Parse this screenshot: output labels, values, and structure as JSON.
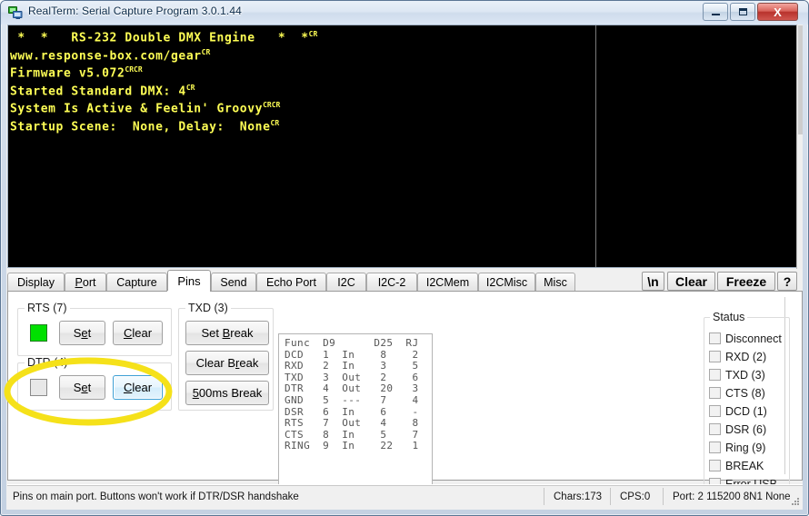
{
  "window": {
    "title": "RealTerm: Serial Capture Program 3.0.1.44",
    "icon": "monitor-icon",
    "minimize_label": "–",
    "maximize_label": "□",
    "close_label": "X"
  },
  "terminal": {
    "lines": [
      " *  *   RS-232 Double DMX Engine   *  *",
      "www.response-box.com/gear",
      "Firmware v5.072",
      "Started Standard DMX: 4",
      "System Is Active & Feelin' Groovy",
      "Startup Scene:  None, Delay:  None"
    ],
    "full_text": " *  *   RS-232 Double DMX Engine   *  *CR\nwww.response-box.com/gearCR\nFirmware v5.072CRCR\nStarted Standard DMX: 4CR\nSystem Is Active & Feelin' GroovyCRCR\nStartup Scene:  None, Delay:  NoneCR",
    "fg_color": "#ffff55",
    "bg_color": "#000000"
  },
  "tabs": [
    {
      "label": "Display",
      "active": false
    },
    {
      "label": "Port",
      "active": false
    },
    {
      "label": "Capture",
      "active": false
    },
    {
      "label": "Pins",
      "active": true
    },
    {
      "label": "Send",
      "active": false
    },
    {
      "label": "Echo Port",
      "active": false
    },
    {
      "label": "I2C",
      "active": false
    },
    {
      "label": "I2C-2",
      "active": false
    },
    {
      "label": "I2CMem",
      "active": false
    },
    {
      "label": "I2CMisc",
      "active": false
    },
    {
      "label": "Misc",
      "active": false
    }
  ],
  "toolbar": [
    {
      "label": "\\n",
      "name": "newline-button"
    },
    {
      "label": "Clear",
      "name": "clear-button"
    },
    {
      "label": "Freeze",
      "name": "freeze-button"
    },
    {
      "label": "?",
      "name": "help-button"
    }
  ],
  "rts_group": {
    "title": "RTS (7)",
    "led_state": "on",
    "led_color": "#00e000",
    "set_label": "Set",
    "clear_label": "Clear"
  },
  "dtr_group": {
    "title": "DTR (4)",
    "led_state": "off",
    "set_label": "Set",
    "clear_label": "Clear"
  },
  "txd_group": {
    "title": "TXD (3)",
    "set_break_label": "Set Break",
    "clear_break_label": "Clear Break",
    "ms_break_label": "500ms Break"
  },
  "pin_table": {
    "header": [
      "Func",
      "D9",
      "",
      "D25",
      "RJ"
    ],
    "rows": [
      [
        "DCD",
        "1",
        "In",
        "8",
        "2"
      ],
      [
        "RXD",
        "2",
        "In",
        "3",
        "5"
      ],
      [
        "TXD",
        "3",
        "Out",
        "2",
        "6"
      ],
      [
        "DTR",
        "4",
        "Out",
        "20",
        "3"
      ],
      [
        "GND",
        "5",
        "---",
        "7",
        "4"
      ],
      [
        "DSR",
        "6",
        "In",
        "6",
        "-"
      ],
      [
        "RTS",
        "7",
        "Out",
        "4",
        "8"
      ],
      [
        "CTS",
        "8",
        "In",
        "5",
        "7"
      ],
      [
        "RING",
        "9",
        "In",
        "22",
        "1"
      ]
    ],
    "text": "Func  D9      D25  RJ\nDCD   1  In    8    2\nRXD   2  In    3    5\nTXD   3  Out   2    6\nDTR   4  Out   20   3\nGND   5  ---   7    4\nDSR   6  In    6    -\nRTS   7  Out   4    8\nCTS   8  In    5    7\nRING  9  In    22   1"
  },
  "status_group": {
    "title": "Status",
    "items": [
      {
        "label": "Disconnect",
        "checked": false
      },
      {
        "label": "RXD (2)",
        "checked": false
      },
      {
        "label": "TXD (3)",
        "checked": false
      },
      {
        "label": "CTS (8)",
        "checked": false
      },
      {
        "label": "DCD (1)",
        "checked": false
      },
      {
        "label": "DSR (6)",
        "checked": false
      },
      {
        "label": "Ring (9)",
        "checked": false
      },
      {
        "label": "BREAK",
        "checked": false
      },
      {
        "label": "Error  USB",
        "checked": false
      }
    ]
  },
  "statusbar": {
    "hint": "Pins on main port. Buttons won't work if DTR/DSR handshake",
    "chars": "Chars:173",
    "cps": "CPS:0",
    "port": "Port: 2  115200 8N1 None"
  },
  "annotation": {
    "shape": "ellipse",
    "color": "#f5e11a"
  }
}
